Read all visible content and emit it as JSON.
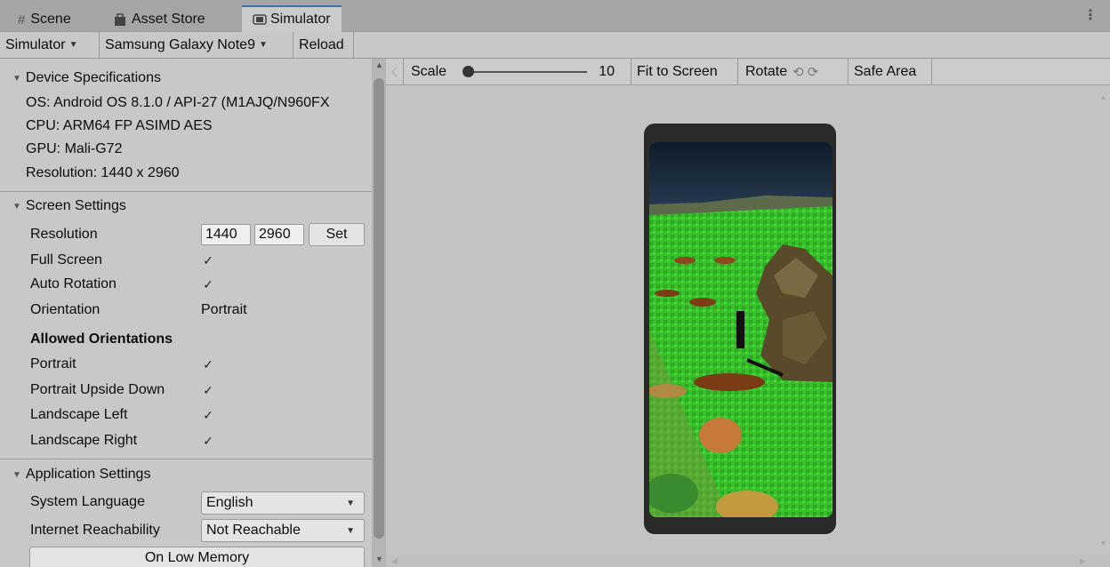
{
  "tabs": [
    {
      "label": "Scene",
      "icon": "grid-icon"
    },
    {
      "label": "Asset Store",
      "icon": "bag-icon"
    },
    {
      "label": "Simulator",
      "icon": "phone-icon",
      "active": true
    }
  ],
  "toolbar": {
    "simulator_menu": "Simulator",
    "device_menu": "Samsung Galaxy Note9",
    "reload": "Reload"
  },
  "device_specs": {
    "header": "Device Specifications",
    "os": "OS: Android OS 8.1.0 / API-27 (M1AJQ/N960FX",
    "cpu": "CPU: ARM64 FP ASIMD AES",
    "gpu": "GPU: Mali-G72",
    "resolution": "Resolution: 1440 x 2960"
  },
  "screen_settings": {
    "header": "Screen Settings",
    "resolution_label": "Resolution",
    "res_width": "1440",
    "res_height": "2960",
    "set_button": "Set",
    "full_screen_label": "Full Screen",
    "auto_rotation_label": "Auto Rotation",
    "orientation_label": "Orientation",
    "orientation_value": "Portrait",
    "allowed_header": "Allowed Orientations",
    "portrait": "Portrait",
    "portrait_upside_down": "Portrait Upside Down",
    "landscape_left": "Landscape Left",
    "landscape_right": "Landscape Right",
    "check_glyph": "✓"
  },
  "app_settings": {
    "header": "Application Settings",
    "language_label": "System Language",
    "language_value": "English",
    "reachability_label": "Internet Reachability",
    "reachability_value": "Not Reachable",
    "low_memory_button": "On Low Memory"
  },
  "sim_toolbar": {
    "scale_label": "Scale",
    "scale_value": "10",
    "fit": "Fit to Screen",
    "rotate": "Rotate",
    "safe_area": "Safe Area"
  },
  "colors": {
    "accent": "#3a72b0",
    "grass": "#3bbd2f",
    "phone_frame": "#2a2a2a"
  }
}
